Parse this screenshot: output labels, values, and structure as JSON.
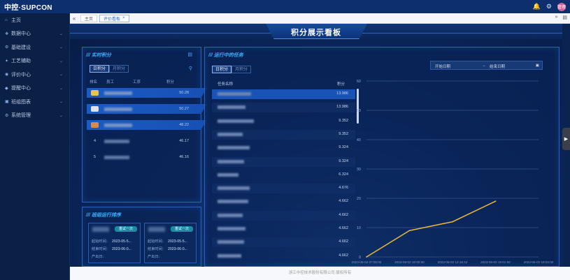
{
  "app": {
    "brand": "中控·SUPCON"
  },
  "topbar": {
    "bell_icon": "bell-icon",
    "gear_icon": "gear-icon",
    "avatar_text": "管理"
  },
  "sidebar": {
    "items": [
      {
        "label": "主页",
        "icon": "home-icon"
      },
      {
        "label": "数据中心",
        "icon": "data-icon",
        "chevron": "⌄"
      },
      {
        "label": "基础建设",
        "icon": "gear-icon",
        "chevron": "⌄"
      },
      {
        "label": "工艺辅助",
        "icon": "wrench-icon",
        "chevron": "⌄"
      },
      {
        "label": "评价中心",
        "icon": "eye-icon",
        "chevron": "⌄"
      },
      {
        "label": "提醒中心",
        "icon": "bell-icon",
        "chevron": "⌄"
      },
      {
        "label": "班组图表",
        "icon": "chart-icon",
        "chevron": "⌄"
      },
      {
        "label": "系统管理",
        "icon": "settings-icon",
        "chevron": "⌄"
      }
    ]
  },
  "tabs": [
    {
      "label": "主页"
    },
    {
      "label": "评价看板",
      "active": true
    }
  ],
  "dashboard": {
    "title": "积分展示看板",
    "realtime": {
      "title": "实时积分",
      "tabs": [
        "日积分",
        "月积分"
      ],
      "columns": [
        "排名",
        "员工",
        "工序",
        "积分"
      ],
      "rows": [
        {
          "rank": "",
          "score": "50.28"
        },
        {
          "rank": "",
          "score": "50.27"
        },
        {
          "rank": "",
          "score": "48.22"
        },
        {
          "rank": "4",
          "score": "46.17"
        },
        {
          "rank": "5",
          "score": "46.16"
        }
      ]
    },
    "running": {
      "title": "班组运行排序",
      "cards": [
        {
          "button": "重试一次",
          "start_label": "起始时间：",
          "start": "2023-05-5...",
          "end_label": "结束时间：",
          "end": "2023-06-0...",
          "output_label": "产出日："
        },
        {
          "button": "重试一次",
          "start_label": "起始时间：",
          "start": "2023-05-5...",
          "end_label": "结束时间：",
          "end": "2023-06-0...",
          "output_label": "产出日："
        }
      ]
    },
    "tasks": {
      "title": "运行中的任务",
      "tabs": [
        "日积分",
        "月积分"
      ],
      "columns": [
        "任务名称",
        "积分"
      ],
      "scores": [
        "13.986",
        "13.986",
        "9.352",
        "9.352",
        "9.324",
        "9.324",
        "6.324",
        "4.676",
        "4.662",
        "4.662",
        "4.662",
        "4.662",
        "4.662"
      ]
    },
    "date_range": {
      "start": "开始日期",
      "separator": "→",
      "end": "结束日期"
    }
  },
  "chart_data": {
    "type": "line",
    "x": [
      "2023-06-02 07:05:00",
      "2023-06-02 10:00:00",
      "2023-06-02 12:18:12",
      "2023-06-02 15:01:00",
      "2023-06-02 19:04:00"
    ],
    "series": [
      {
        "values": [
          0,
          9,
          12,
          19,
          null
        ]
      }
    ],
    "ylim": [
      0,
      60
    ],
    "yticks": [
      "0",
      "10",
      "20",
      "30",
      "40",
      "50",
      "60"
    ],
    "grid": true,
    "colors": {
      "line": "#e5b53d",
      "grid": "#4a6aa3"
    }
  },
  "footer": {
    "text": "浙江中控技术股份有限公司 版权所有"
  }
}
